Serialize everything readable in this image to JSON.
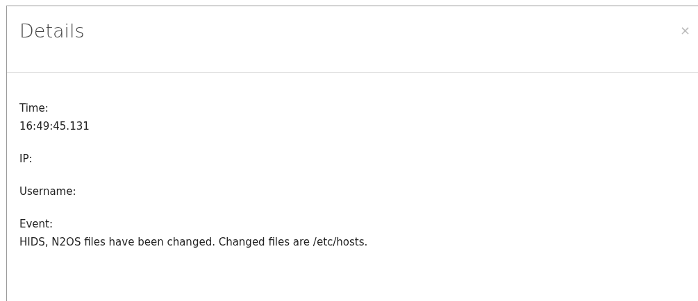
{
  "dialog": {
    "title": "Details",
    "close": "×",
    "fields": [
      {
        "label": "Time:",
        "value": "16:49:45.131"
      },
      {
        "label": "IP:"
      },
      {
        "label": "Username:"
      },
      {
        "label": "Event:",
        "value": "HIDS, N2OS files have been changed. Changed files are /etc/hosts."
      }
    ]
  }
}
